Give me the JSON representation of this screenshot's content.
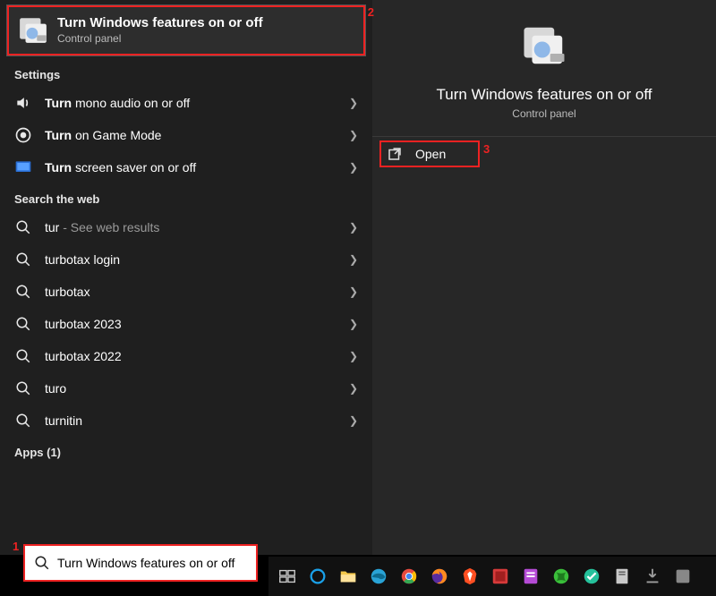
{
  "best_match": {
    "title": "Turn Windows features on or off",
    "subtitle": "Control panel",
    "callout": "2"
  },
  "sections": {
    "settings_label": "Settings",
    "web_label": "Search the web",
    "apps_label": "Apps (1)"
  },
  "settings_items": [
    {
      "prefix": "Turn",
      "rest": " mono audio on or off",
      "icon": "speaker"
    },
    {
      "prefix": "Turn",
      "rest": " on Game Mode",
      "icon": "gamemode"
    },
    {
      "prefix": "Turn",
      "rest": " screen saver on or off",
      "icon": "screensaver"
    }
  ],
  "web_items": [
    {
      "term": "tur",
      "suffix": " - See web results"
    },
    {
      "term": "turbotax login",
      "suffix": ""
    },
    {
      "term": "turbotax",
      "suffix": ""
    },
    {
      "term": "turbotax 2023",
      "suffix": ""
    },
    {
      "term": "turbotax 2022",
      "suffix": ""
    },
    {
      "term": "turo",
      "suffix": ""
    },
    {
      "term": "turnitin",
      "suffix": ""
    }
  ],
  "preview": {
    "title": "Turn Windows features on or off",
    "subtitle": "Control panel",
    "open_label": "Open",
    "open_callout": "3"
  },
  "search": {
    "query": "Turn Windows features on or off",
    "callout": "1"
  },
  "taskbar": [
    {
      "name": "task-view",
      "color": "#ccc"
    },
    {
      "name": "cortana",
      "color": "#1aa0e8"
    },
    {
      "name": "file-explorer",
      "color": "#f5c84b"
    },
    {
      "name": "edge",
      "color": "#29a3d6"
    },
    {
      "name": "chrome",
      "color": "#e8e8e8"
    },
    {
      "name": "firefox",
      "color": "#ff8a1e"
    },
    {
      "name": "brave",
      "color": "#ff4f22"
    },
    {
      "name": "snip",
      "color": "#d63a3a"
    },
    {
      "name": "notes",
      "color": "#b54bd6"
    },
    {
      "name": "xbox",
      "color": "#3abf3a"
    },
    {
      "name": "wondershare",
      "color": "#25c19b"
    },
    {
      "name": "files",
      "color": "#c9c9c9"
    },
    {
      "name": "downloads",
      "color": "#9e9e9e"
    },
    {
      "name": "more",
      "color": "#888"
    }
  ]
}
